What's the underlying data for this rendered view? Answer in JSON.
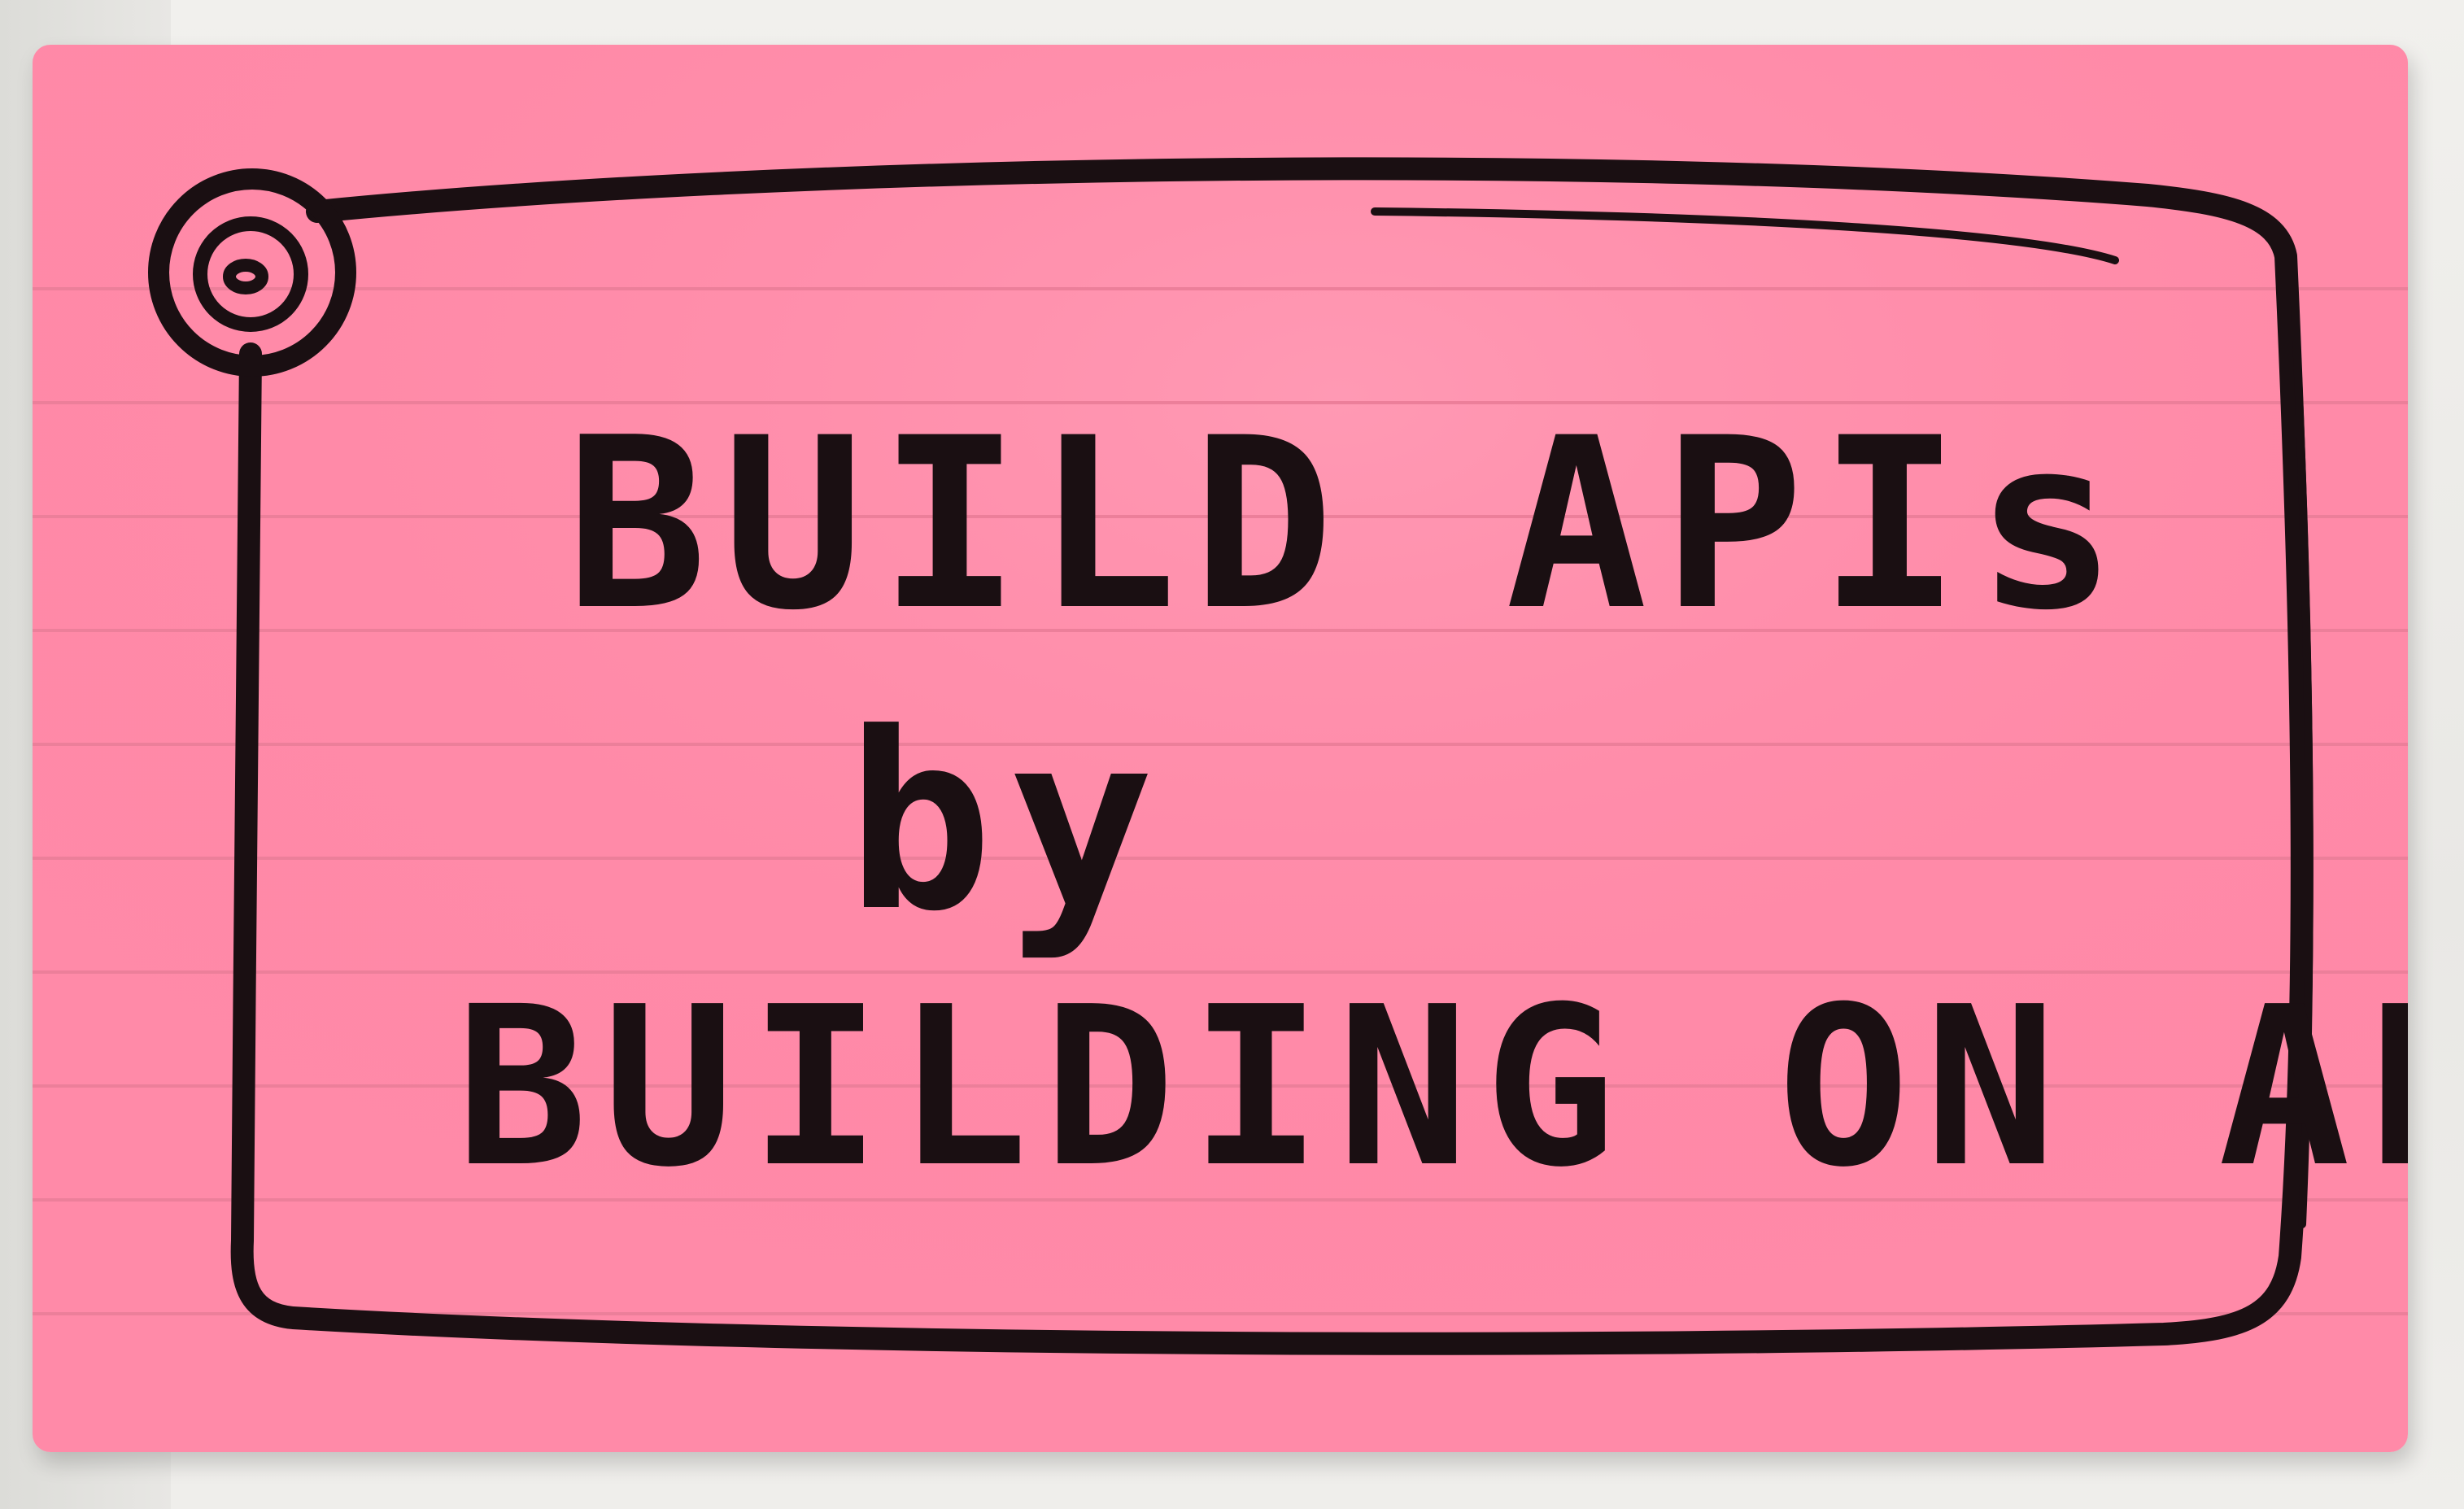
{
  "card": {
    "color": "#ff8aa8",
    "line_color": "#ec7f9a",
    "ink_color": "#1a0f12",
    "lines": [
      "BUILD APIs",
      "by",
      "BUILDING ON APIs"
    ]
  }
}
